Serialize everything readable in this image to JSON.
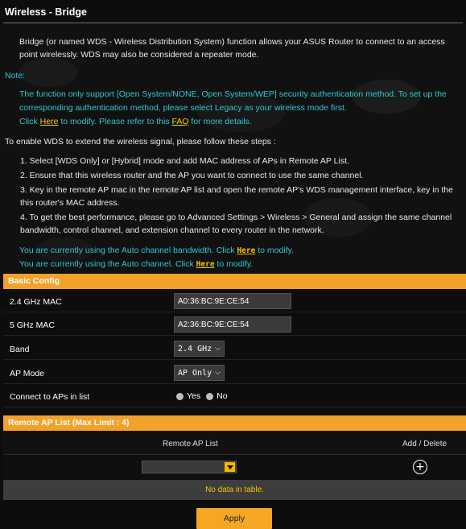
{
  "title": "Wireless - Bridge",
  "intro": "Bridge (or named WDS - Wireless Distribution System) function allows your ASUS Router to connect to an access point wirelessly. WDS may also be considered a repeater mode.",
  "note": {
    "label": "Note:",
    "line1": "The function only support [Open System/NONE, Open System/WEP] security authentication method. To set up the corresponding authentication method, please select Legacy as your wireless mode first.",
    "click": "Click ",
    "here": "Here",
    "modify_refer": " to modify. Please refer to this ",
    "faq": "FAQ",
    "more": " for more details."
  },
  "steps_intro": "To enable WDS to extend the wireless signal, please follow these steps :",
  "steps": [
    "1. Select [WDS Only] or [Hybrid] mode and add MAC address of APs in Remote AP List.",
    "2. Ensure that this wireless router and the AP you want to connect to use the same channel.",
    "3. Key in the remote AP mac in the remote AP list and open the remote AP's WDS management interface, key in the this router's MAC address.",
    "4. To get the best performance, please go to Advanced Settings > Wireless > General and assign the same channel bandwidth, control channel, and extension channel to every router in the network."
  ],
  "current": {
    "bandwidth_pre": "You are currently using the Auto channel bandwidth. Click ",
    "channel_pre": "You are currently using the Auto channel. Click ",
    "here": "Here",
    "post": " to modify."
  },
  "basic_config": {
    "header": "Basic Config",
    "mac24_label": "2.4 GHz MAC",
    "mac24_value": "A0:36:BC:9E:CE:54",
    "mac5_label": "5 GHz MAC",
    "mac5_value": "A2:36:BC:9E:CE:54",
    "band_label": "Band",
    "band_value": "2.4 GHz",
    "ap_mode_label": "AP Mode",
    "ap_mode_value": "AP Only",
    "connect_label": "Connect to APs in list",
    "yes_label": "Yes",
    "no_label": "No"
  },
  "remote_list": {
    "header": "Remote AP List (Max Limit : 4)",
    "col_remote": "Remote AP List",
    "col_add": "Add / Delete",
    "no_data": "No data in table."
  },
  "apply_label": "Apply"
}
